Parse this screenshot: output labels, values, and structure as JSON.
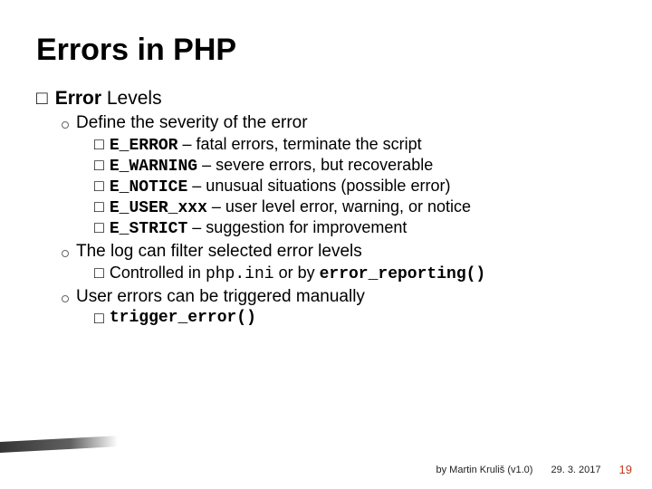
{
  "title": "Errors in PHP",
  "section": {
    "marker": "□",
    "text1": "Error",
    "text2": " Levels"
  },
  "subs": {
    "define": "Define the severity of the error",
    "filter": "The log can filter selected error levels",
    "manual": "User errors can be triggered manually"
  },
  "levels": [
    {
      "sq": "□",
      "code": "E_ERROR",
      "desc": " – fatal errors, terminate the script"
    },
    {
      "sq": "□",
      "code": "E_WARNING",
      "desc": " – severe errors, but recoverable"
    },
    {
      "sq": "□",
      "code": "E_NOTICE",
      "desc": " – unusual situations (possible error)"
    },
    {
      "sq": "□",
      "code": "E_USER_xxx",
      "desc": " – user level error, warning, or notice"
    },
    {
      "sq": "□",
      "code": "E_STRICT",
      "desc": " – suggestion for improvement"
    }
  ],
  "controlled": {
    "sq": "□",
    "pre": "Controlled in ",
    "file": "php.ini",
    "mid": " or by ",
    "fn": "error_reporting()"
  },
  "trigger": {
    "sq": "□",
    "fn": "trigger_error()"
  },
  "footer": {
    "author": "by Martin Kruliš (v1.0)",
    "date": "29. 3. 2017",
    "page": "19"
  }
}
